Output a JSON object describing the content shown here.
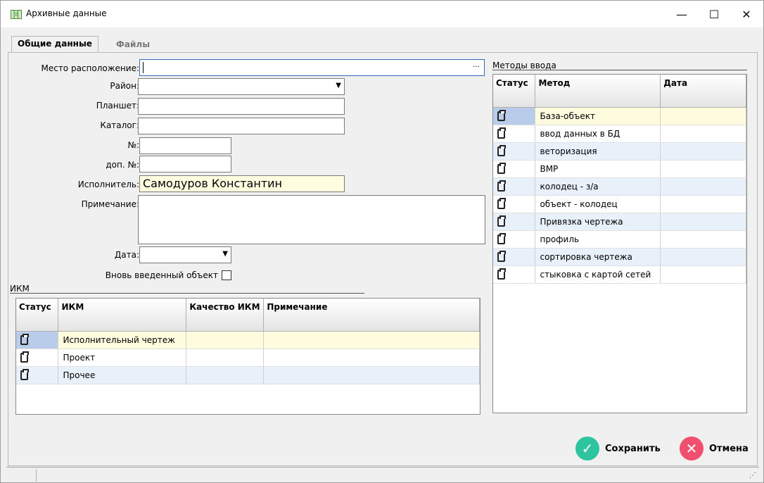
{
  "window": {
    "title": "Архивные данные",
    "min": "—",
    "max": "☐",
    "close": "✕"
  },
  "tabs": [
    "Общие данные",
    "Файлы"
  ],
  "form": {
    "location_label": "Место расположение:",
    "location_value": "",
    "location_browse": "...",
    "district_label": "Район:",
    "district_value": "",
    "tablet_label": "Планшет:",
    "tablet_value": "",
    "catalog_label": "Каталог:",
    "catalog_value": "",
    "number_label": "№:",
    "number_value": "",
    "extra_number_label": "доп. №:",
    "extra_number_value": "",
    "executor_label": "Исполнитель:",
    "executor_value": "Самодуров Константин",
    "note_label": "Примечание:",
    "note_value": "",
    "date_label": "Дата:",
    "date_value": "",
    "new_object_label": "Вновь введенный объект"
  },
  "ikm": {
    "title": "ИКМ",
    "columns": [
      "Статус",
      "ИКМ",
      "Качество ИКМ",
      "Примечание"
    ],
    "rows": [
      {
        "name": "Исполнительный чертеж",
        "quality": "",
        "note": ""
      },
      {
        "name": "Проект",
        "quality": "",
        "note": ""
      },
      {
        "name": "Прочее",
        "quality": "",
        "note": ""
      }
    ]
  },
  "methods": {
    "title": "Методы ввода",
    "columns": [
      "Статус",
      "Метод",
      "Дата"
    ],
    "rows": [
      {
        "name": "База-объект",
        "date": ""
      },
      {
        "name": "ввод данных в БД",
        "date": ""
      },
      {
        "name": "веторизация",
        "date": ""
      },
      {
        "name": "ВМР",
        "date": ""
      },
      {
        "name": "колодец - з/а",
        "date": ""
      },
      {
        "name": "объект - колодец",
        "date": ""
      },
      {
        "name": "Привязка чертежа",
        "date": ""
      },
      {
        "name": "профиль",
        "date": ""
      },
      {
        "name": "сортировка чертежа",
        "date": ""
      },
      {
        "name": "стыковка с картой сетей",
        "date": ""
      }
    ]
  },
  "actions": {
    "save": "Сохранить",
    "cancel": "Отмена",
    "save_color": "#2ec4a0",
    "cancel_color": "#f0506e"
  }
}
